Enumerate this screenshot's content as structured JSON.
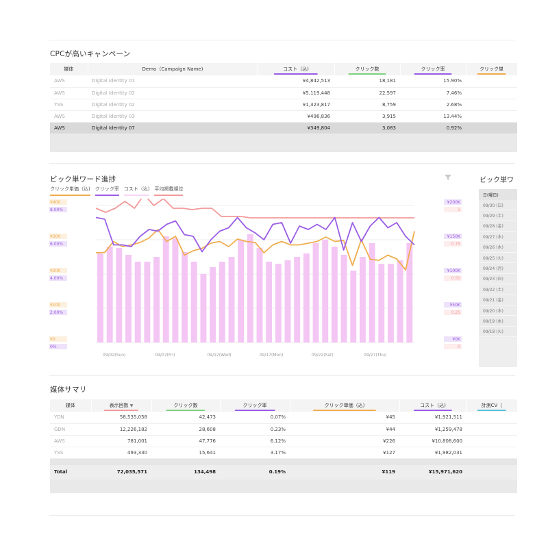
{
  "colors": {
    "green": "#7fd17f",
    "purple": "#9b5de5",
    "orange": "#f0ad4e",
    "pink": "#f4c6f4",
    "salmon": "#f29a9a",
    "lightpink": "#f7d6f7",
    "teal": "#5bc0de"
  },
  "campaign_table": {
    "title": "CPCが高いキャンペーン",
    "headers": [
      "媒体",
      "Demo（Campaign Name)",
      "コスト（込)",
      "クリック数",
      "クリック率",
      "クリック単"
    ],
    "rows": [
      [
        "AWS",
        "Digital Identity 01",
        "¥4,842,513",
        "18,181",
        "15.90%"
      ],
      [
        "AWS",
        "Digital Identity 02",
        "¥5,119,448",
        "22,597",
        "7.46%"
      ],
      [
        "YSS",
        "Digital Identity 02",
        "¥1,323,817",
        "8,759",
        "2.68%"
      ],
      [
        "AWS",
        "Digital Identity 03",
        "¥496,836",
        "3,915",
        "13.44%"
      ],
      [
        "AWS",
        "Digital Identity 07",
        "¥349,804",
        "3,083",
        "0.92%"
      ]
    ]
  },
  "chart": {
    "title": "ビック単ワード進捗",
    "legend": [
      {
        "label": "クリック単価（込)",
        "color_key": "orange"
      },
      {
        "label": "クリック率",
        "color_key": "purple"
      },
      {
        "label": "コスト（込)",
        "color_key": "lightpink"
      },
      {
        "label": "平均掲載順位",
        "color_key": "salmon"
      }
    ]
  },
  "chart_data": {
    "type": "bar",
    "x_ticks": [
      "09/02(Sun)",
      "09/07(Fri)",
      "09/12(Wed)",
      "09/17(Mon)",
      "09/22(Sat)",
      "09/27(Thu)"
    ],
    "left_ticks_cpc": [
      "¥0",
      "¥100",
      "¥200",
      "¥300",
      "¥400"
    ],
    "left_ticks_ctr": [
      "0%",
      "2.00%",
      "4.00%",
      "6.00%",
      "8.00%"
    ],
    "right_ticks_cost": [
      "¥0K",
      "¥50K",
      "¥100K",
      "¥150K",
      "¥200K"
    ],
    "right_ticks_rank": [
      "0",
      "0.25",
      "0.50",
      "0.75",
      "1"
    ],
    "ylim_cost": [
      0,
      200
    ],
    "ylim_cpc": [
      0,
      400
    ],
    "ylim_ctr": [
      0,
      8
    ],
    "ylim_rank": [
      0,
      1
    ],
    "series": [
      {
        "name": "コスト（込)",
        "type": "bar",
        "axis": "cost",
        "values": [
          130,
          140,
          138,
          128,
          118,
          118,
          125,
          155,
          152,
          132,
          118,
          100,
          110,
          118,
          125,
          150,
          158,
          138,
          118,
          115,
          120,
          125,
          130,
          145,
          150,
          140,
          128,
          105,
          125,
          145,
          115,
          115,
          120,
          145
        ]
      },
      {
        "name": "平均掲載順位",
        "type": "line",
        "axis": "rank",
        "values": [
          0.98,
          0.95,
          0.98,
          1.03,
          0.98,
          1.08,
          1.0,
          1.05,
          0.98,
          0.98,
          0.97,
          0.98,
          0.98,
          0.92,
          0.92,
          0.92,
          0.91,
          0.91,
          0.91,
          0.91,
          0.91,
          0.91,
          0.91,
          0.91,
          0.91,
          0.91,
          0.91,
          0.91,
          0.91,
          0.91,
          0.91,
          0.91,
          0.91,
          0.91
        ]
      },
      {
        "name": "クリック単価（込)",
        "type": "line",
        "axis": "cpc",
        "values": [
          262,
          263,
          295,
          280,
          285,
          292,
          305,
          330,
          295,
          310,
          255,
          268,
          275,
          290,
          295,
          280,
          302,
          295,
          292,
          262,
          285,
          295,
          285,
          285,
          290,
          295,
          308,
          295,
          298,
          225,
          300,
          243,
          240,
          255,
          244,
          212,
          325
        ]
      },
      {
        "name": "クリック率",
        "type": "line",
        "axis": "ctr",
        "values": [
          7.3,
          7.2,
          5.7,
          5.7,
          5.6,
          6.2,
          6.6,
          6.5,
          6.9,
          7.1,
          6.3,
          6.2,
          5.3,
          6.0,
          6.5,
          6.7,
          7.3,
          6.7,
          6.4,
          6.0,
          6.9,
          7.0,
          5.8,
          6.8,
          6.6,
          6.9,
          6.6,
          7.3,
          5.4,
          7.0,
          5.9,
          6.8,
          7.3,
          6.7,
          7.0,
          6.2,
          5.7
        ]
      }
    ]
  },
  "side_table": {
    "title": "ビック単ワ",
    "header": "日(曜日)",
    "rows": [
      "09/30 (日)",
      "09/29 (土)",
      "09/28 (金)",
      "09/27 (木)",
      "09/26 (水)",
      "09/25 (火)",
      "09/24 (月)",
      "09/23 (日)",
      "09/22 (土)",
      "09/21 (金)",
      "09/20 (木)",
      "09/19 (水)",
      "09/18 (火)"
    ]
  },
  "media_table": {
    "title": "媒体サマリ",
    "headers": [
      "媒体",
      "表示回数",
      "クリック数",
      "クリック率",
      "クリック単価（込)",
      "コスト（込)",
      "計測CV（"
    ],
    "sort_indicator": "▼",
    "rows": [
      [
        "YDN",
        "58,535,058",
        "42,473",
        "0.07%",
        "¥45",
        "¥1,921,511"
      ],
      [
        "GDN",
        "12,226,182",
        "28,608",
        "0.23%",
        "¥44",
        "¥1,259,478"
      ],
      [
        "AWS",
        "781,001",
        "47,776",
        "6.12%",
        "¥226",
        "¥10,808,600"
      ],
      [
        "YSS",
        "493,330",
        "15,641",
        "3.17%",
        "¥127",
        "¥1,982,031"
      ]
    ],
    "total": [
      "Total",
      "72,035,571",
      "134,498",
      "0.19%",
      "¥119",
      "¥15,971,620"
    ]
  }
}
